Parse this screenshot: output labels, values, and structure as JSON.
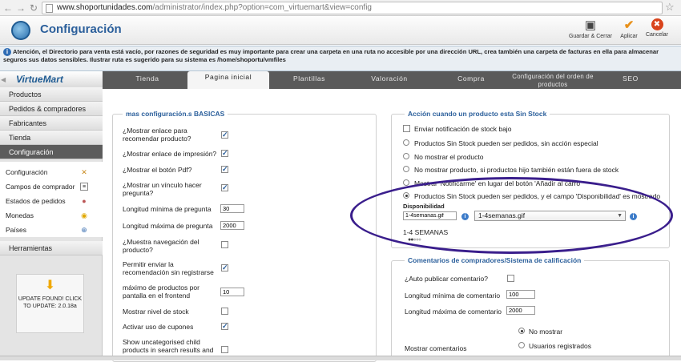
{
  "browser": {
    "url_host": "www.shoportunidades.com",
    "url_path": "/administrator/index.php?option=com_virtuemart&view=config"
  },
  "header": {
    "title": "Configuración",
    "buttons": [
      {
        "label": "Guardar & Cerrar",
        "icon": "save-icon"
      },
      {
        "label": "Aplicar",
        "icon": "check-icon"
      },
      {
        "label": "Cancelar",
        "icon": "cancel-icon"
      }
    ]
  },
  "notice": {
    "text": "Atención, el Directorio para venta está vacío, por razones de seguridad es muy importante para crear una carpeta en una ruta no accesible por una dirección URL, crea también una carpeta de facturas en ella para almacenar seguros sus datos sensibles. Ilustrar ruta es sugerido para su sistema es /home/shoportu/vmfiles"
  },
  "sidebar": {
    "logo": "VirtueMart",
    "sections": [
      "Productos",
      "Pedidos & compradores",
      "Fabricantes",
      "Tienda",
      "Configuración"
    ],
    "sub_items": [
      {
        "label": "Configuración",
        "icon": "tools-icon"
      },
      {
        "label": "Campos de comprador",
        "icon": "form-icon"
      },
      {
        "label": "Estados de pedidos",
        "icon": "status-icon"
      },
      {
        "label": "Monedas",
        "icon": "coins-icon"
      },
      {
        "label": "Países",
        "icon": "globe-icon"
      }
    ],
    "tools": "Herramientas",
    "update": "UPDATE FOUND! CLICK TO UPDATE: 2.0.18a"
  },
  "tabs": [
    "Tienda",
    "Pagina inicial",
    "Plantillas",
    "Valoración",
    "Compra",
    "Configuración del orden de productos",
    "SEO"
  ],
  "basic": {
    "legend": "mas configuración.s BASICAS",
    "rows": [
      {
        "label": "¿Mostrar enlace para recomendar producto?",
        "checked": true
      },
      {
        "label": "¿Mostrar enlace de impresión?",
        "checked": true
      },
      {
        "label": "¿Mostrar el botón Pdf?",
        "checked": true
      },
      {
        "label": "¿Mostrar un vínculo hacer pregunta?",
        "checked": true
      },
      {
        "label": "Longitud mínima de pregunta",
        "value": "30"
      },
      {
        "label": "Longitud máxima de pregunta",
        "value": "2000"
      },
      {
        "label": "¿Muestra navegación del producto?",
        "checked": false
      },
      {
        "label": "Permitir enviar la recomendación sin registrarse",
        "checked": true
      },
      {
        "label": "máximo de productos por pantalla en el frontend",
        "value": "10"
      },
      {
        "label": "Mostrar nivel de stock",
        "checked": false
      },
      {
        "label": "Activar uso de cupones",
        "checked": true
      },
      {
        "label": "Show uncategorised child products in search results and",
        "checked": false
      }
    ]
  },
  "stock": {
    "legend": "Acción cuando un producto esta Sin Stock",
    "notify_label": "Enviar notificación de stock bajo",
    "options": [
      "Productos Sin Stock pueden ser pedidos, sin acción especial",
      "No mostrar el producto",
      "No mostrar producto, si productos hijo también están fuera de stock",
      "Mostrar 'Notificarme' en lugar del botón 'Añadir al carro'",
      "Productos Sin Stock pueden ser pedidos, y el campo 'Disponibilidad' es mostrado"
    ],
    "selected_option": 4,
    "availability_label": "Disponibilidad",
    "availability_value": "1-4semanas.gif",
    "availability_select": "1-4semanas.gif",
    "availability_text": "1-4 SEMANAS"
  },
  "comments": {
    "legend": "Comentarios de compradores/Sistema de calificación",
    "rows": [
      {
        "label": "¿Auto publicar comentario?",
        "checked": false
      },
      {
        "label": "Longitud mínima de comentario",
        "value": "100"
      },
      {
        "label": "Longitud máxima de comentario",
        "value": "2000"
      }
    ],
    "show_label": "Mostrar comentarios",
    "show_options": [
      "No mostrar",
      "Usuarios registrados"
    ],
    "show_selected": 0
  }
}
